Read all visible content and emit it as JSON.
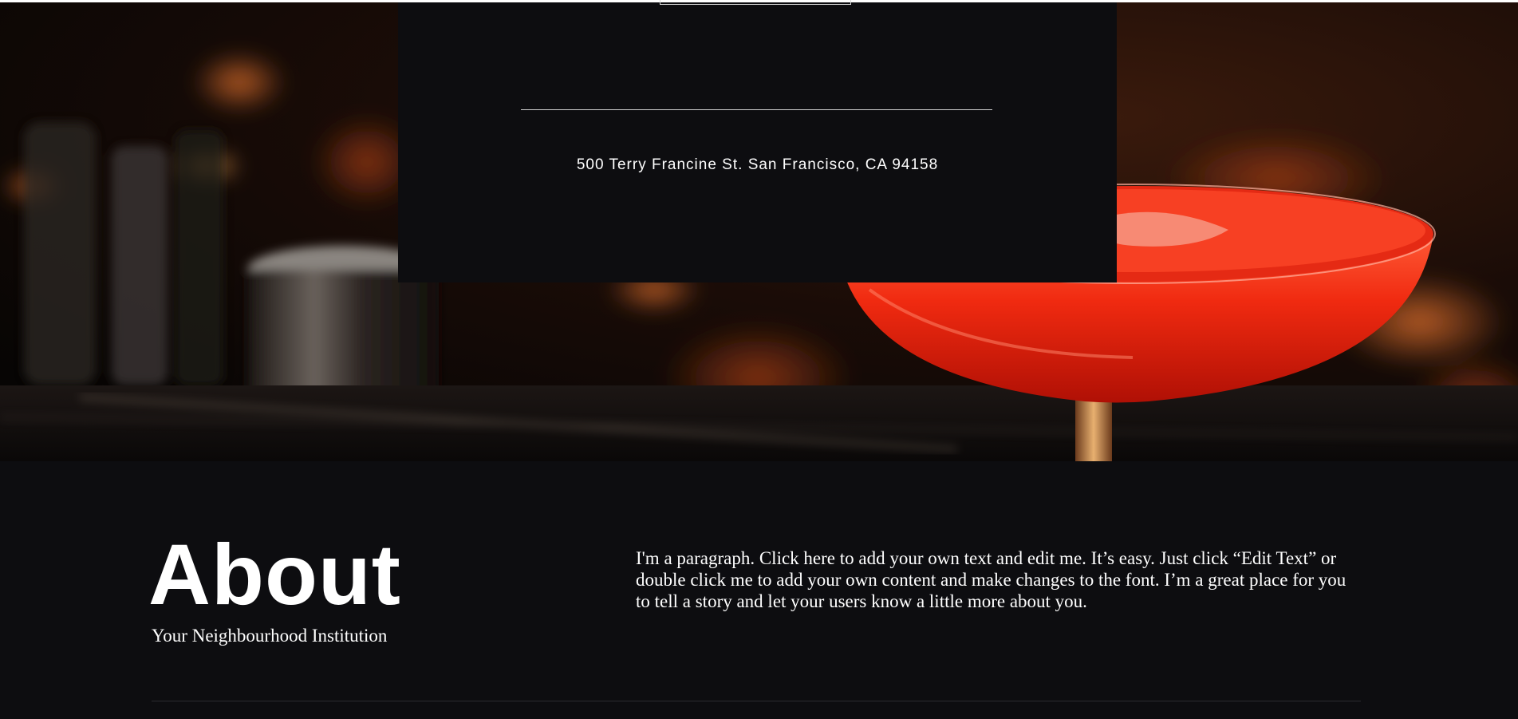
{
  "hero": {
    "image": "cocktail-bar-photo",
    "accent_color": "#e0200e"
  },
  "card": {
    "address": "500 Terry Francine St. San Francisco, CA 94158",
    "background_color": "#0d0d10"
  },
  "about": {
    "title": "About",
    "subtitle": "Your Neighbourhood Institution",
    "paragraph": "I'm a paragraph. Click here to add your own text and edit me. It’s easy. Just click “Edit Text” or double click me to add your own content and make changes to the font. I’m a great place for you to tell a story and let your users know a little more about you."
  }
}
